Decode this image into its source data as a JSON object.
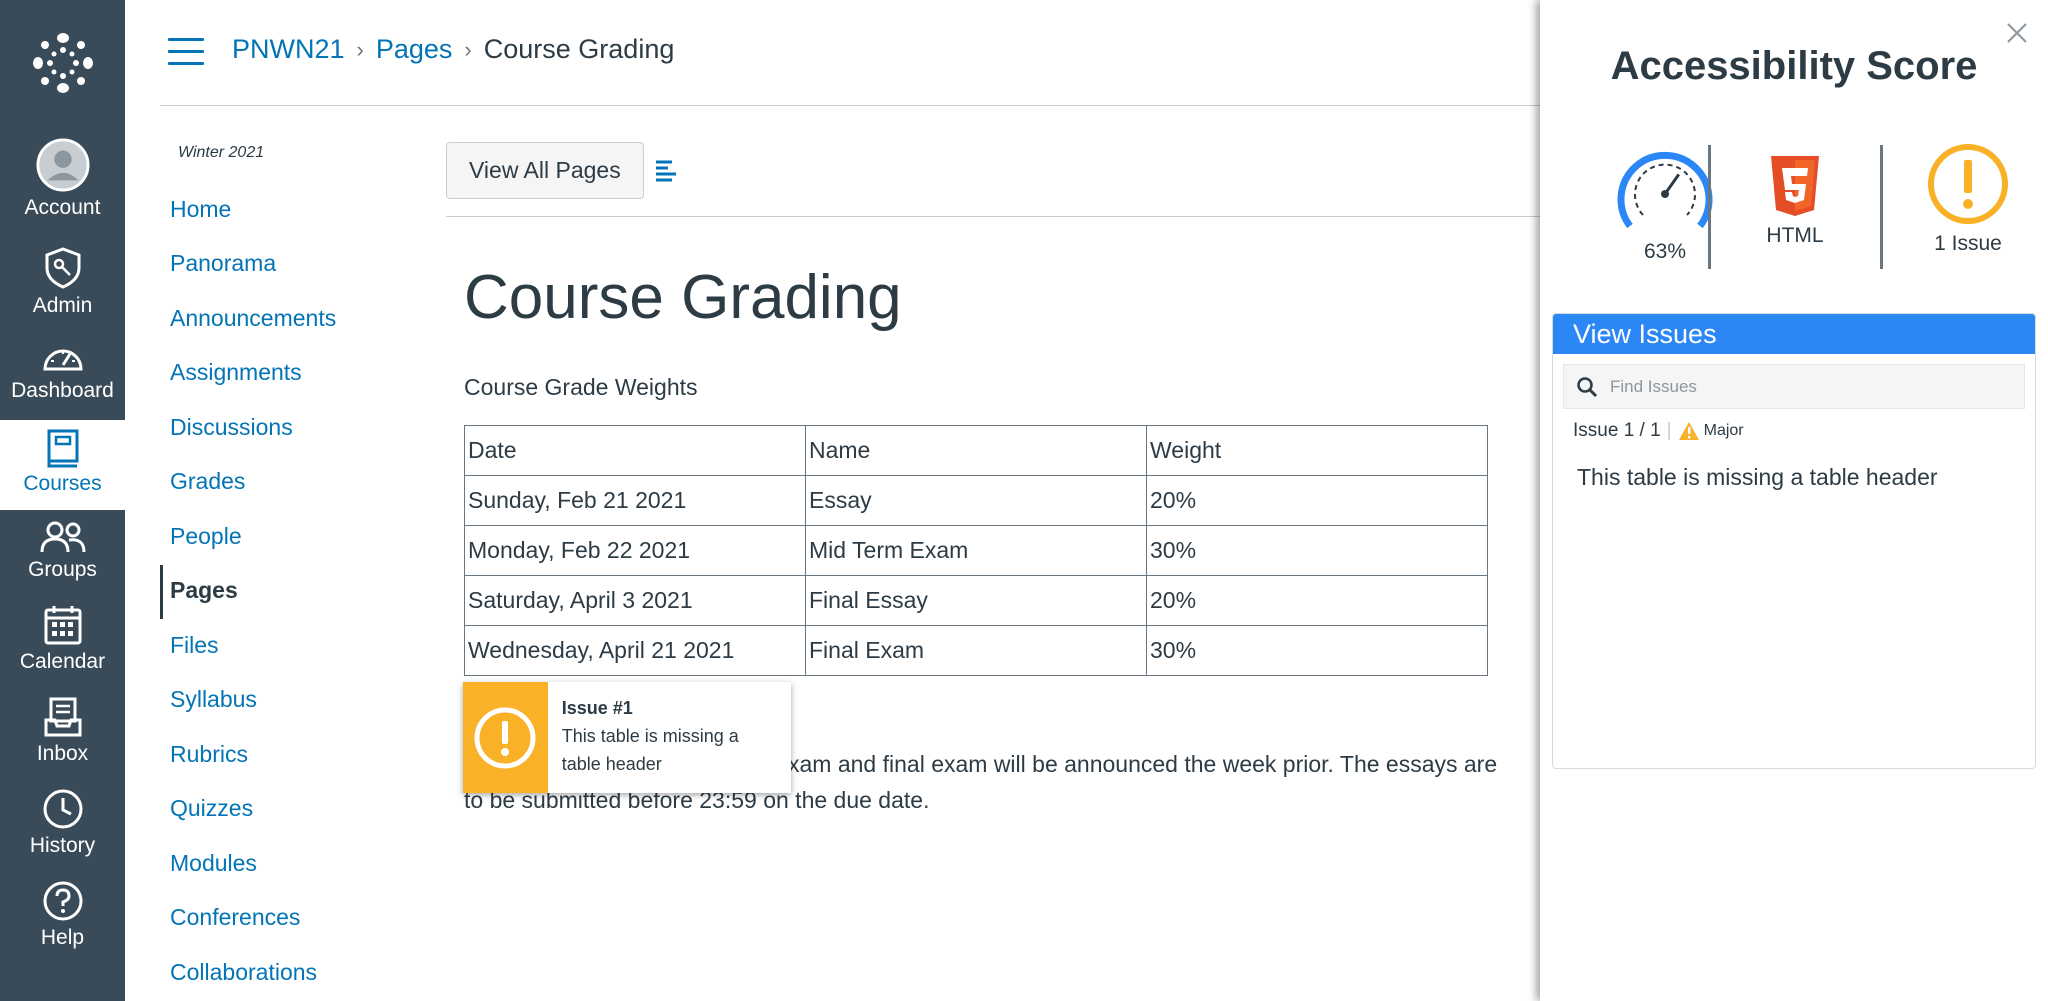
{
  "global_nav": {
    "items": [
      {
        "label": "Account",
        "icon": "account-icon"
      },
      {
        "label": "Admin",
        "icon": "admin-icon"
      },
      {
        "label": "Dashboard",
        "icon": "dashboard-icon"
      },
      {
        "label": "Courses",
        "icon": "courses-icon",
        "active": true
      },
      {
        "label": "Groups",
        "icon": "groups-icon"
      },
      {
        "label": "Calendar",
        "icon": "calendar-icon"
      },
      {
        "label": "Inbox",
        "icon": "inbox-icon"
      },
      {
        "label": "History",
        "icon": "history-icon"
      },
      {
        "label": "Help",
        "icon": "help-icon"
      }
    ]
  },
  "breadcrumb": {
    "course": "PNWN21",
    "section": "Pages",
    "current": "Course Grading"
  },
  "course_nav": {
    "term": "Winter 2021",
    "items": [
      "Home",
      "Panorama",
      "Announcements",
      "Assignments",
      "Discussions",
      "Grades",
      "People",
      "Pages",
      "Files",
      "Syllabus",
      "Rubrics",
      "Quizzes",
      "Modules",
      "Conferences",
      "Collaborations"
    ],
    "active": "Pages"
  },
  "toolbar": {
    "view_all_label": "View All Pages"
  },
  "page": {
    "title": "Course Grading",
    "section_label": "Course Grade Weights",
    "table": {
      "header": [
        "Date",
        "Name",
        "Weight"
      ],
      "rows": [
        [
          "Sunday, Feb 21 2021",
          "Essay",
          "20%"
        ],
        [
          "Monday, Feb 22 2021",
          "Mid Term Exam",
          "30%"
        ],
        [
          "Saturday, April 3 2021",
          "Final Essay",
          "20%"
        ],
        [
          "Wednesday, April 21 2021",
          "Final Exam",
          "30%"
        ]
      ]
    },
    "paragraph_visible_1": "xam and final exam will be announced the week prior. The essays are",
    "paragraph_visible_2": "to be submitted before 23:59 on the due date."
  },
  "tooltip": {
    "title": "Issue #1",
    "message": "This table is missing a table header"
  },
  "panel": {
    "title": "Accessibility Score",
    "score": "63%",
    "score_value": 0.63,
    "format": "HTML",
    "issues_count": "1 Issue",
    "view_issues_label": "View Issues",
    "search_placeholder": "Find Issues",
    "issue_position": "Issue 1 / 1",
    "severity": "Major",
    "issue_message": "This table is missing a table header"
  },
  "colors": {
    "nav_bg": "#394b58",
    "link": "#0374b5",
    "accent_blue": "#2b87f5",
    "warning": "#f9b127",
    "html5": "#e44d26"
  }
}
